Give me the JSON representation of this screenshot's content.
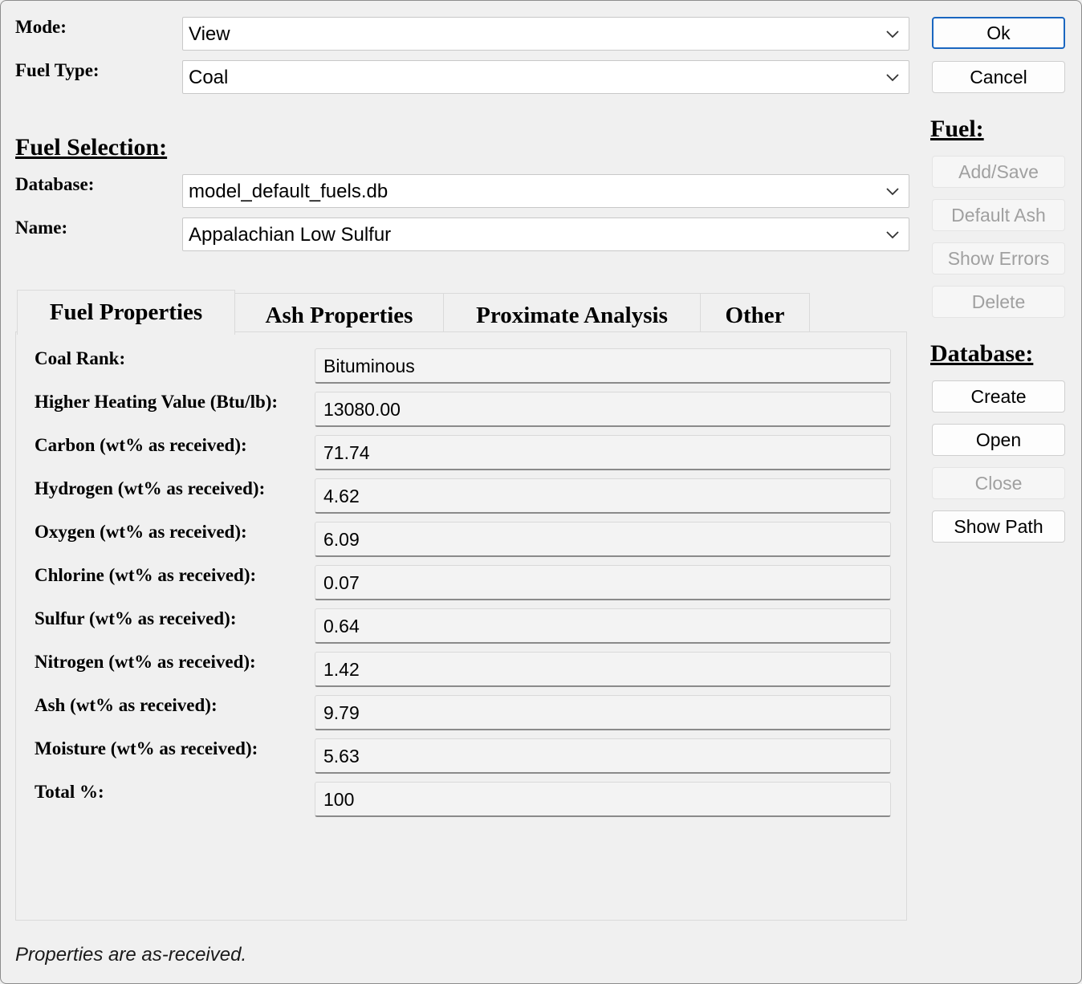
{
  "mode": {
    "label": "Mode:",
    "value": "View"
  },
  "fuel_type": {
    "label": "Fuel Type:",
    "value": "Coal"
  },
  "fuel_selection": {
    "title": "Fuel Selection:",
    "database_label": "Database:",
    "database_value": "model_default_fuels.db",
    "name_label": "Name:",
    "name_value": "Appalachian Low Sulfur"
  },
  "buttons": {
    "ok": "Ok",
    "cancel": "Cancel"
  },
  "fuel_group": {
    "title": "Fuel:",
    "add_save": "Add/Save",
    "default_ash": "Default Ash",
    "show_errors": "Show Errors",
    "delete": "Delete"
  },
  "database_group": {
    "title": "Database:",
    "create": "Create",
    "open": "Open",
    "close": "Close",
    "show_path": "Show Path"
  },
  "tabs": [
    {
      "label": "Fuel Properties",
      "active": true
    },
    {
      "label": "Ash Properties",
      "active": false
    },
    {
      "label": "Proximate Analysis",
      "active": false
    },
    {
      "label": "Other",
      "active": false
    }
  ],
  "properties": [
    {
      "label": "Coal Rank:",
      "value": "Bituminous"
    },
    {
      "label": "Higher Heating Value (Btu/lb):",
      "value": "13080.00"
    },
    {
      "label": "Carbon (wt% as received):",
      "value": "71.74"
    },
    {
      "label": "Hydrogen (wt% as received):",
      "value": "4.62"
    },
    {
      "label": "Oxygen (wt% as received):",
      "value": "6.09"
    },
    {
      "label": "Chlorine (wt% as received):",
      "value": "0.07"
    },
    {
      "label": "Sulfur (wt% as received):",
      "value": "0.64"
    },
    {
      "label": "Nitrogen (wt% as received):",
      "value": "1.42"
    },
    {
      "label": "Ash (wt% as received):",
      "value": "9.79"
    },
    {
      "label": "Moisture (wt% as received):",
      "value": "5.63"
    },
    {
      "label": "Total %:",
      "value": "100"
    }
  ],
  "footer_note": "Properties are as-received.",
  "colors": {
    "accent": "#1a66c0",
    "background": "#f0f0f0",
    "disabled_text": "#a0a0a0"
  }
}
